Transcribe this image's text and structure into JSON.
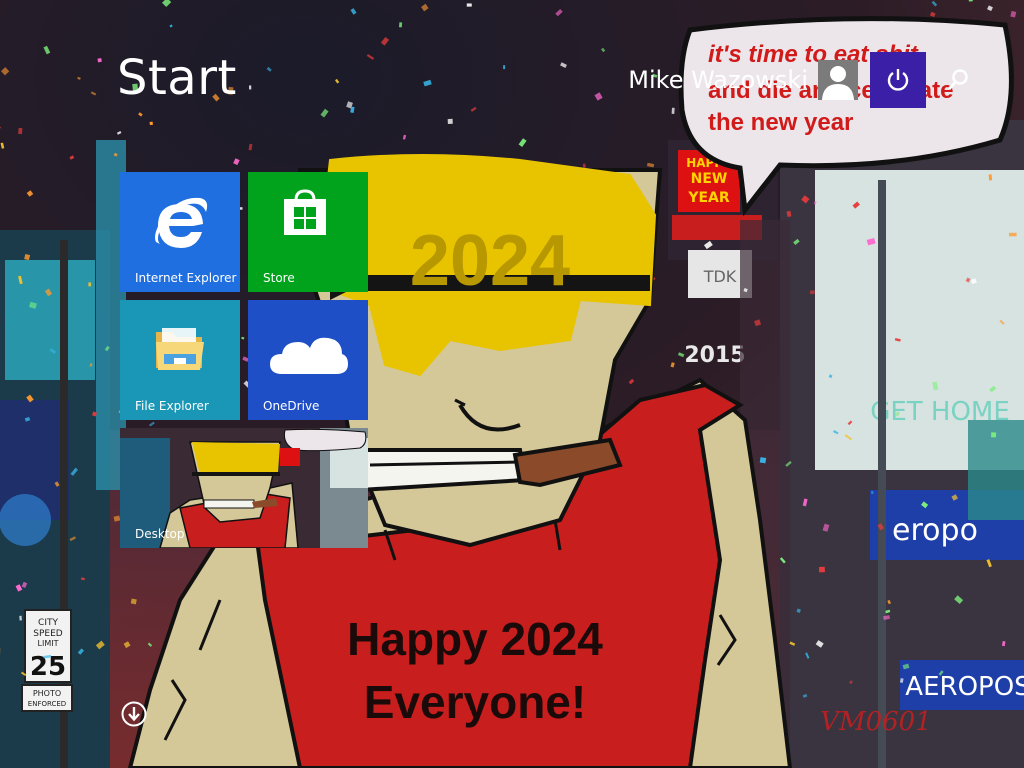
{
  "start": {
    "title": "Start"
  },
  "user": {
    "name": "Mike Wazowski",
    "avatar_icon": "user-silhouette-icon"
  },
  "buttons": {
    "power_icon": "power-icon",
    "search_icon": "search-icon",
    "all_apps_icon": "arrow-down-circle-icon"
  },
  "tiles": [
    {
      "label": "Internet Explorer",
      "color": "#1f6fe0",
      "icon": "internet-explorer-icon"
    },
    {
      "label": "Store",
      "color": "#00a31b",
      "icon": "store-icon"
    },
    {
      "label": "File Explorer",
      "color": "#1a97b6",
      "icon": "file-explorer-icon"
    },
    {
      "label": "OneDrive",
      "color": "#1e4fc7",
      "icon": "onedrive-icon"
    },
    {
      "label": "Desktop",
      "color": "#333333",
      "icon": "desktop-wallpaper-thumbnail"
    }
  ],
  "wallpaper": {
    "speech_bubble_lines": [
      "it's time to eat shit",
      "and die and celebrate",
      "the new year"
    ],
    "glasses_text": "2024",
    "shirt_lines": [
      "Happy 2024",
      "Everyone!"
    ],
    "signature": "VM0601",
    "billboard_happy_new_year": [
      "HAPPY",
      "NEW",
      "YEAR"
    ],
    "billboard_tdk": "TDK",
    "billboard_2015": "2015",
    "billboard_get_home": "GET HOME",
    "billboard_aero": "eropo",
    "billboard_aeropos": "AEROPOS",
    "sign_city_speed": [
      "CITY",
      "SPEED",
      "LIMIT"
    ],
    "sign_speed_value": "25",
    "sign_photo": [
      "PHOTO",
      "ENFORCED"
    ],
    "colors": {
      "shirt": "#c81e1e",
      "skin": "#d4c798",
      "hair": "#e8c400",
      "bubble": "#ece6ea",
      "bubble_text": "#d11a1a"
    }
  }
}
